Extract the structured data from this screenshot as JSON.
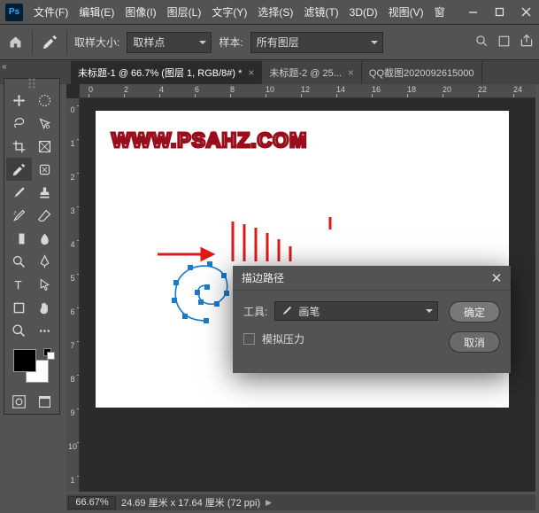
{
  "menu": {
    "items": [
      "文件(F)",
      "编辑(E)",
      "图像(I)",
      "图层(L)",
      "文字(Y)",
      "选择(S)",
      "滤镜(T)",
      "3D(D)",
      "视图(V)",
      "窗"
    ]
  },
  "options": {
    "sample_size_label": "取样大小:",
    "sample_size_value": "取样点",
    "sample_label": "样本:",
    "sample_value": "所有图层"
  },
  "tabs": [
    {
      "label": "未标题-1 @ 66.7% (图层 1, RGB/8#) *",
      "active": true
    },
    {
      "label": "未标题-2 @ 25...",
      "active": false
    },
    {
      "label": "QQ截图2020092615000",
      "active": false
    }
  ],
  "ruler_h": [
    "0",
    "2",
    "4",
    "6",
    "8",
    "10",
    "12",
    "14",
    "16",
    "18",
    "20",
    "22",
    "24"
  ],
  "ruler_v": [
    "0",
    "1",
    "2",
    "3",
    "4",
    "5",
    "6",
    "7",
    "8",
    "9",
    "10",
    "1"
  ],
  "canvas": {
    "watermark": "WWW.PSAHZ.COM"
  },
  "dialog": {
    "title": "描边路径",
    "tool_label": "工具:",
    "tool_value": "画笔",
    "pressure": "模拟压力",
    "ok": "确定",
    "cancel": "取消"
  },
  "status": {
    "zoom": "66.67%",
    "dims": "24.69 厘米 x 17.64 厘米 (72 ppi)",
    "caret": "▶"
  }
}
